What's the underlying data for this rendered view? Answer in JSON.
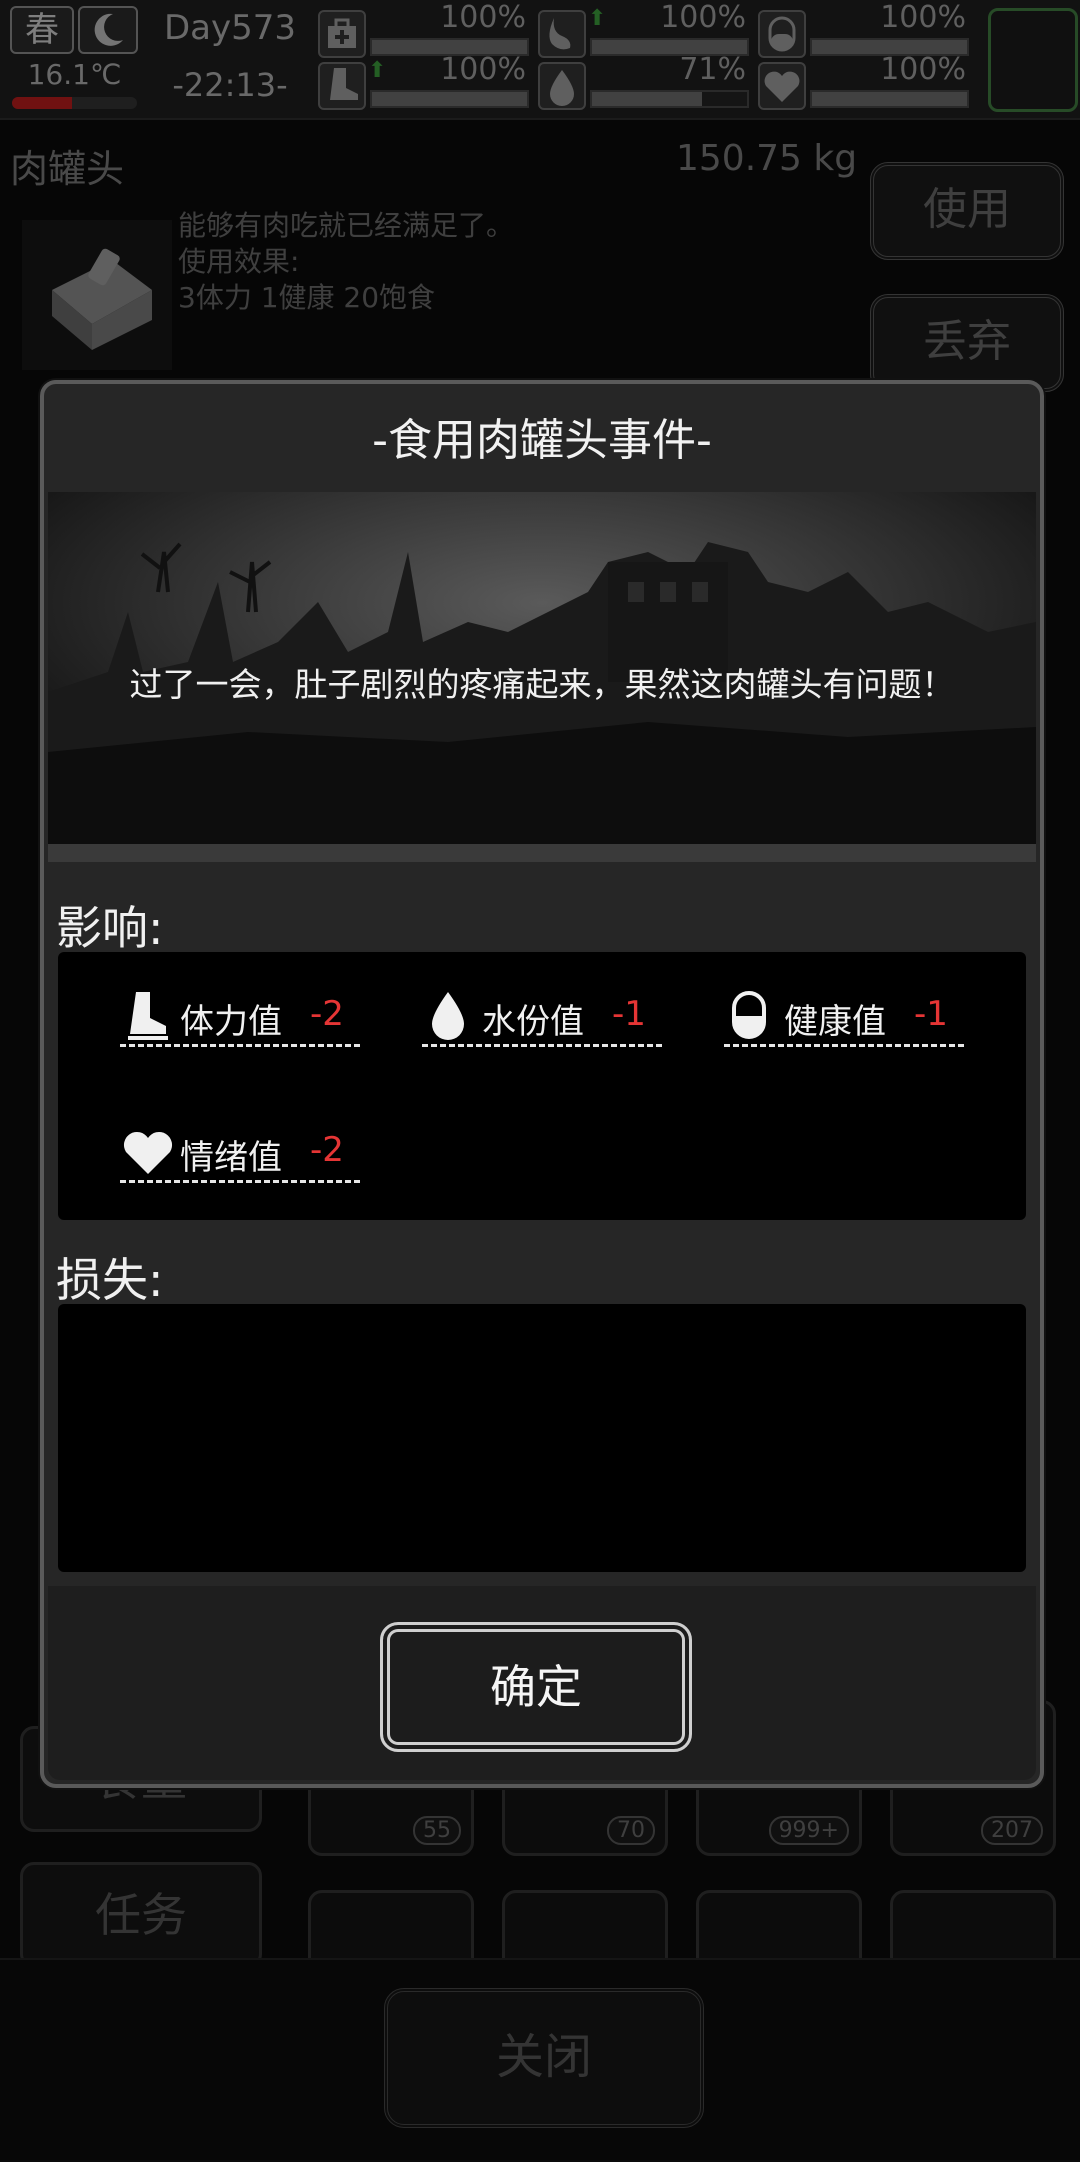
{
  "status": {
    "season": "春",
    "temperature": "16.1℃",
    "day": "Day573",
    "time": "-22:13-",
    "stats": [
      {
        "icon": "medkit-icon",
        "pct": "100%",
        "value": 1.0
      },
      {
        "icon": "stomach-icon",
        "pct": "100%",
        "value": 1.0
      },
      {
        "icon": "pill-icon",
        "pct": "100%",
        "value": 1.0
      },
      {
        "icon": "boot-icon",
        "pct": "100%",
        "value": 1.0
      },
      {
        "icon": "water-drop-icon",
        "pct": "71%",
        "value": 0.71
      },
      {
        "icon": "heart-icon",
        "pct": "100%",
        "value": 1.0
      }
    ]
  },
  "item": {
    "name": "肉罐头",
    "weight": "150.75 kg",
    "desc_line1": "能够有肉吃就已经满足了。",
    "desc_line2": "使用效果:",
    "desc_line3": "3体力 1健康 20饱食",
    "use_label": "使用",
    "discard_label": "丢弃"
  },
  "background": {
    "tab_food": "食量",
    "tab_tasks": "任务",
    "badges": [
      "55",
      "70",
      "999+",
      "207"
    ],
    "close_label": "关闭"
  },
  "modal": {
    "title": "-食用肉罐头事件-",
    "event_text": "过了一会，肚子剧烈的疼痛起来，果然这肉罐头有问题！",
    "effects_label": "影响:",
    "effects": [
      {
        "icon": "boot-icon",
        "label": "体力值",
        "value": "-2"
      },
      {
        "icon": "water-drop-icon",
        "label": "水份值",
        "value": "-1"
      },
      {
        "icon": "pill-icon",
        "label": "健康值",
        "value": "-1"
      },
      {
        "icon": "heart-icon",
        "label": "情绪值",
        "value": "-2"
      }
    ],
    "loss_label": "损失:",
    "confirm_label": "确定"
  },
  "colors": {
    "negative": "#e53535",
    "temp_bar": "#b51c1c",
    "slot_border": "#3f7a3f"
  }
}
